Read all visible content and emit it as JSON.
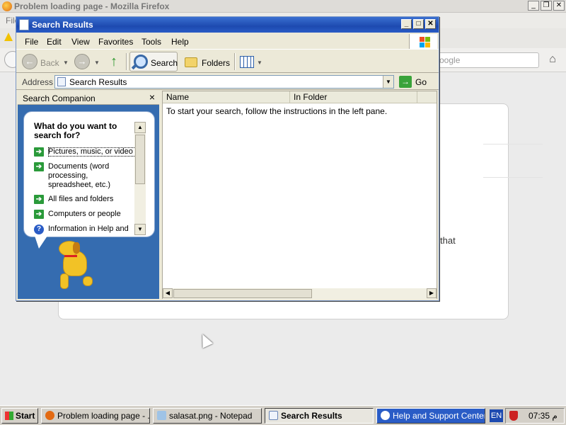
{
  "firefox": {
    "title": "Problem loading page - Mozilla Firefox",
    "menu_first": "File",
    "search_placeholder": "oogle",
    "body_fragment": "that",
    "controls": {
      "minimize": "_",
      "restore": "❐",
      "close": "✕"
    }
  },
  "explorer": {
    "title": "Search Results",
    "title_controls": {
      "minimize": "_",
      "maximize": "□",
      "close": "✕"
    },
    "menu": [
      "File",
      "Edit",
      "View",
      "Favorites",
      "Tools",
      "Help"
    ],
    "toolbar": {
      "back_label": "Back",
      "search_label": "Search",
      "folders_label": "Folders"
    },
    "address": {
      "label": "Address",
      "value": "Search Results",
      "go_label": "Go"
    },
    "companion": {
      "title": "Search Companion",
      "question": "What do you want to search for?",
      "options": [
        "Pictures, music, or video",
        "Documents (word processing, spreadsheet, etc.)",
        "All files and folders",
        "Computers or people",
        "Information in Help and"
      ]
    },
    "results": {
      "columns": [
        "Name",
        "In Folder"
      ],
      "empty_message": "To start your search, follow the instructions in the left pane."
    }
  },
  "taskbar": {
    "start_label": "Start",
    "tasks": [
      "Problem loading page - ...",
      "salasat.png - Notepad",
      "Search Results",
      "Help and Support Center"
    ],
    "language": "EN",
    "clock": "07:35 م"
  },
  "colors": {
    "xp_title_blue": "#1d4ab0",
    "companion_blue": "#356cb0",
    "go_green": "#3aa33a"
  }
}
